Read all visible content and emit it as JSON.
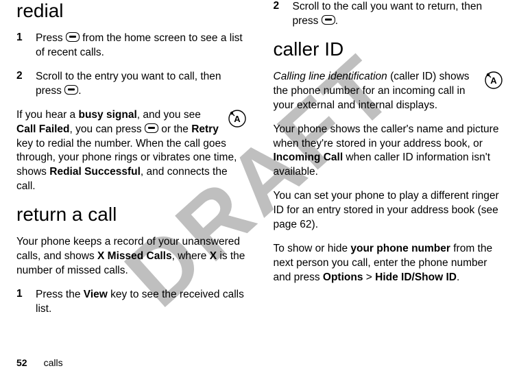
{
  "watermark": "DRAFT",
  "footer": {
    "page_number": "52",
    "section": "calls"
  },
  "left": {
    "heading_redial": "redial",
    "step1_num": "1",
    "step1_a": "Press ",
    "step1_b": " from the home screen to see a list of recent calls.",
    "step2_num": "2",
    "step2_a": "Scroll to the entry you want to call, then press ",
    "step2_b": ".",
    "busy_a": "If you hear a ",
    "busy_bold": "busy signal",
    "busy_b": ", and you see ",
    "call_failed": "Call Failed",
    "busy_c": ", you can press ",
    "busy_d": " or the ",
    "retry": "Retry",
    "busy_e": " key to redial the number. When the call goes through, your phone rings or vibrates one time, shows ",
    "redial_successful": "Redial Successful",
    "busy_f": ", and connects the call.",
    "heading_return": "return a call",
    "return_a": "Your phone keeps a record of your unanswered calls, and shows ",
    "x_missed": "X Missed Calls",
    "return_b": ", where ",
    "x_bold": "X",
    "return_c": " is the number of missed calls.",
    "rstep1_num": "1",
    "rstep1_a": "Press the ",
    "view": "View",
    "rstep1_b": " key to see the received calls list."
  },
  "right": {
    "step2_num": "2",
    "step2_a": "Scroll to the call you want to return, then press ",
    "step2_b": ".",
    "heading_callerid": "caller ID",
    "cid_italic": "Calling line identification",
    "cid_a": " (caller ID) shows the phone number for an incoming call in your external and internal displays.",
    "cid_b1": "Your phone shows the caller's name and picture when they're stored in your address book, or ",
    "incoming_call": "Incoming Call",
    "cid_b2": " when caller ID information isn't available.",
    "cid_c": "You can set your phone to play a different ringer ID for an entry stored in your address book (see page 62).",
    "cid_d1": "To show or hide ",
    "your_phone": "your phone number",
    "cid_d2": " from the next person you call, enter the phone number and press ",
    "options": "Options",
    "gt": " > ",
    "hide_show": "Hide ID/Show ID",
    "cid_d3": "."
  }
}
